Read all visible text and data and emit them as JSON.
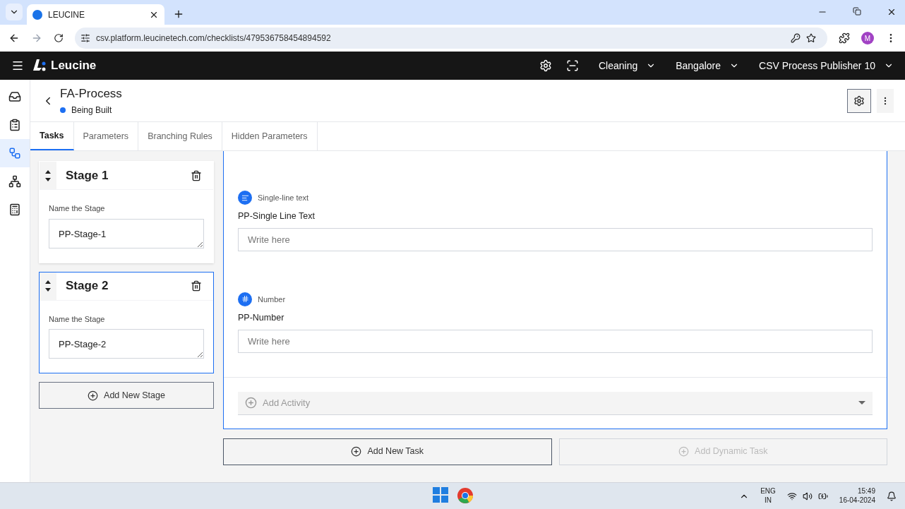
{
  "browser": {
    "tab_title": "LEUCINE",
    "url": "csv.platform.leucinetech.com/checklists/479536758454894592",
    "profile_initial": "M"
  },
  "app_header": {
    "brand": "Leucine",
    "menus": [
      {
        "label": "Cleaning"
      },
      {
        "label": "Bangalore"
      },
      {
        "label": "CSV Process Publisher 10"
      }
    ]
  },
  "sidebar": {
    "items": [
      {
        "kind": "inbox",
        "selected": false
      },
      {
        "kind": "checklist",
        "selected": false
      },
      {
        "kind": "workflow",
        "selected": true
      },
      {
        "kind": "hierarchy",
        "selected": false
      },
      {
        "kind": "report",
        "selected": false
      }
    ]
  },
  "process": {
    "title": "FA-Process",
    "status": "Being Built"
  },
  "tabs": [
    {
      "label": "Tasks",
      "selected": true
    },
    {
      "label": "Parameters",
      "selected": false
    },
    {
      "label": "Branching Rules",
      "selected": false
    },
    {
      "label": "Hidden Parameters",
      "selected": false
    }
  ],
  "stages": [
    {
      "title": "Stage 1",
      "field_label": "Name the Stage",
      "value": "PP-Stage-1",
      "selected": false
    },
    {
      "title": "Stage 2",
      "field_label": "Name the Stage",
      "value": "PP-Stage-2",
      "selected": true
    }
  ],
  "add_stage": "Add New Stage",
  "parameters": [
    {
      "kind": "text",
      "type_label": "Single-line text",
      "name": "PP-Single Line Text",
      "placeholder": "Write here"
    },
    {
      "kind": "number",
      "type_label": "Number",
      "name": "PP-Number",
      "placeholder": "Write here"
    }
  ],
  "add_activity": "Add Activity",
  "task_buttons": [
    {
      "label": "Add New Task",
      "disabled": false
    },
    {
      "label": "Add Dynamic Task",
      "disabled": true
    }
  ],
  "taskbar": {
    "language": "ENG",
    "region": "IN",
    "time": "15:49",
    "date": "16-04-2024"
  }
}
